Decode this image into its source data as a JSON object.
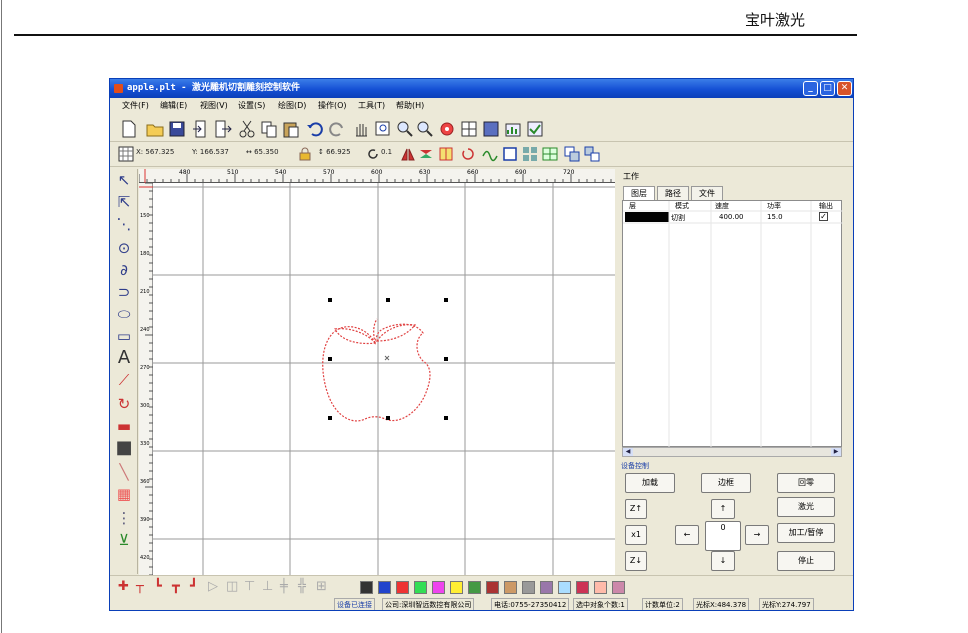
{
  "document": {
    "header_text": "宝叶激光"
  },
  "window": {
    "title": "apple.plt - 激光雕机切割雕刻控制软件",
    "controls": {
      "minimize": "_",
      "maximize": "□",
      "close": "✕"
    }
  },
  "menu": [
    "文件(F)",
    "编辑(E)",
    "视图(V)",
    "设置(S)",
    "绘图(D)",
    "操作(O)",
    "工具(T)",
    "帮助(H)"
  ],
  "toolbar1_icons": [
    "new-file",
    "open-folder",
    "save",
    "import",
    "export",
    "cut",
    "copy",
    "paste",
    "undo",
    "redo",
    "pan-hand",
    "zoom-window",
    "zoom-in",
    "zoom-out",
    "settings-gear",
    "grid-view",
    "fill-square",
    "chart",
    "check"
  ],
  "coordbar": {
    "x": "X: 567.325",
    "y": "Y: 166.537",
    "w": "↔ 65.350",
    "h": "↕ 66.925",
    "rotate": "0.1"
  },
  "ruler_top_labels": [
    "480",
    "510",
    "540",
    "570",
    "600",
    "630",
    "660",
    "690",
    "720"
  ],
  "ruler_left_labels": [
    "150",
    "180",
    "210",
    "240",
    "270",
    "300",
    "330",
    "360",
    "390",
    "420"
  ],
  "right_panel": {
    "title": "工作",
    "tabs": [
      "图层",
      "路径",
      "文件"
    ],
    "layer_table": {
      "headers": [
        "层",
        "模式",
        "速度",
        "功率",
        "输出"
      ],
      "rows": [
        {
          "color": "#000000",
          "mode": "切割",
          "speed": "400.00",
          "power": "15.0",
          "output_checked": true,
          "output_mark": "✓"
        }
      ]
    },
    "scroll": {
      "left": "◀",
      "right": "▶"
    },
    "device_control": {
      "title": "设备控制",
      "buttons": {
        "load": "加载",
        "frame": "边框",
        "home": "回零",
        "z_up": "Z↑",
        "up": "↑",
        "laser": "激光",
        "x1": "x1",
        "left": "←",
        "origin": "0",
        "right": "→",
        "process_pause": "加工/暂停",
        "z_down": "Z↓",
        "down": "↓",
        "stop": "停止"
      }
    }
  },
  "palette_colors": [
    "#333333",
    "#2244cc",
    "#ee3333",
    "#33dd55",
    "#ee44ee",
    "#ffee33",
    "#449944",
    "#aa3333",
    "#cc9966",
    "#999999",
    "#9977aa",
    "#aaddff",
    "#cc3355",
    "#ffbbaa",
    "#cc88aa"
  ],
  "statusbar": {
    "connected": "设备已连接",
    "company": "公司:深圳智远数控有限公司",
    "phone": "电话:0755-27350412",
    "selected": "选中对象个数:1",
    "unit": "计数单位:2",
    "cursor_x": "光标X:484.378",
    "cursor_y": "光标Y:274.797"
  },
  "colors": {
    "titlebar": "#1550d4",
    "canvas_object": "#e04040",
    "ruler_accent": "#dd3333"
  }
}
